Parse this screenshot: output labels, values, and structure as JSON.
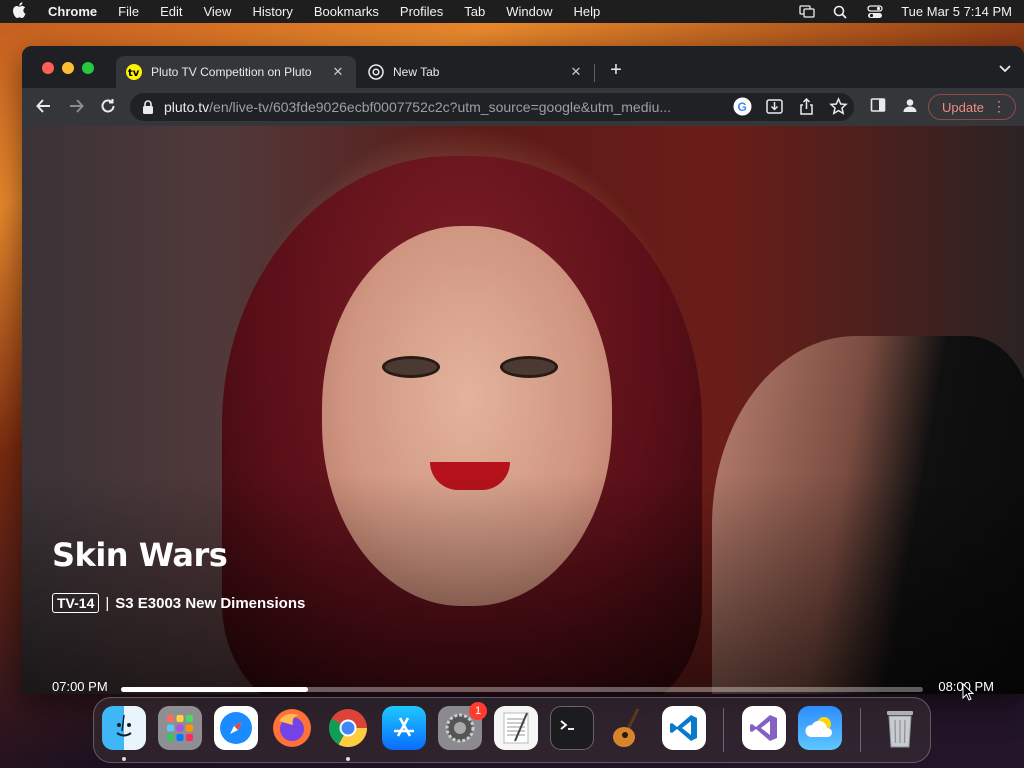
{
  "menubar": {
    "app_name": "Chrome",
    "items": [
      "File",
      "Edit",
      "View",
      "History",
      "Bookmarks",
      "Profiles",
      "Tab",
      "Window",
      "Help"
    ],
    "clock": "Tue Mar 5  7:14 PM"
  },
  "browser": {
    "tabs": [
      {
        "title": "Pluto TV Competition on Pluto",
        "favicon": "tv",
        "active": true
      },
      {
        "title": "New Tab",
        "favicon": "chrome",
        "active": false
      }
    ],
    "url": {
      "host": "pluto.tv",
      "path": "/en/live-tv/603fde9026ecbf0007752c2c?utm_source=google&utm_mediu..."
    },
    "update_label": "Update"
  },
  "player": {
    "title": "Skin Wars",
    "rating": "TV-14",
    "separator": "|",
    "episode": "S3 E3003 New Dimensions",
    "start_time": "07:00 PM",
    "end_time": "08:00 PM",
    "progress_fraction": 0.233
  },
  "dock": {
    "apps": [
      "Finder",
      "Launchpad",
      "Safari",
      "Firefox",
      "Chrome",
      "App Store",
      "System Settings",
      "TextEdit",
      "Terminal",
      "GarageBand",
      "Visual Studio Code",
      "Visual Studio",
      "Weather",
      "Trash"
    ],
    "settings_badge": "1"
  },
  "colors": {
    "accent_red": "#e02626",
    "update_text": "#f28b82",
    "toolbar_bg": "#35363a"
  }
}
